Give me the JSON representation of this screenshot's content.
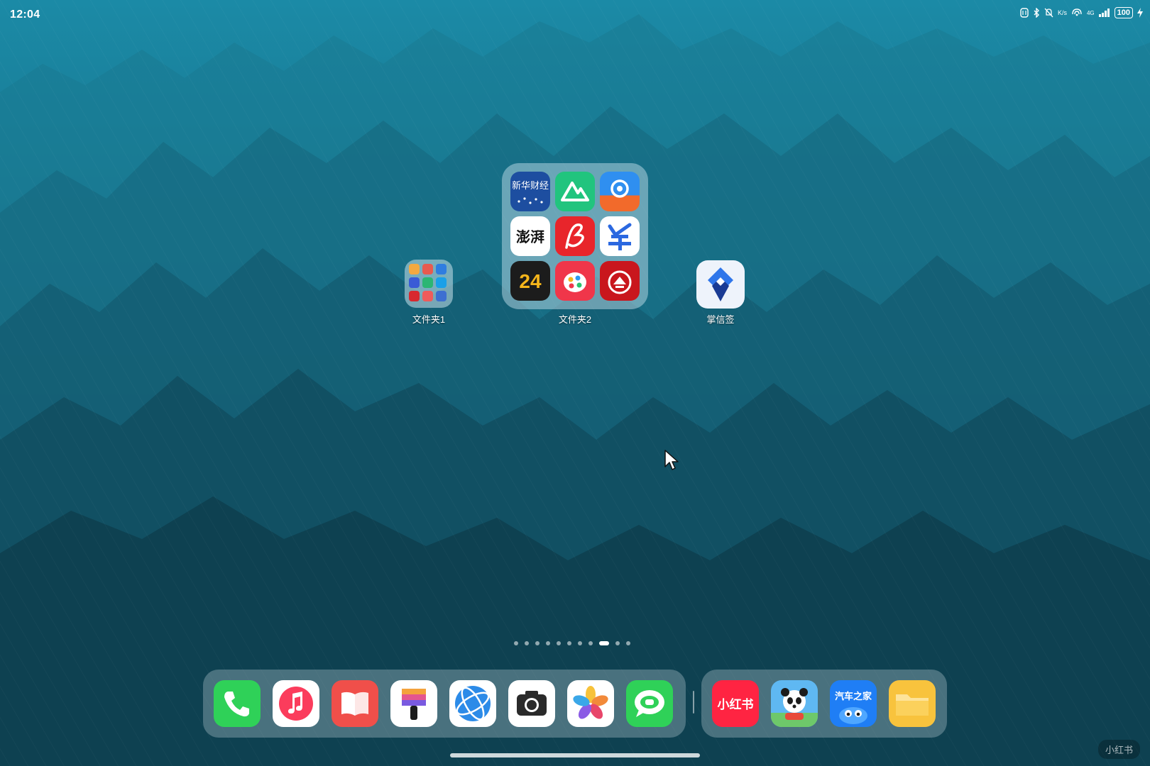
{
  "status_bar": {
    "time": "12:04",
    "net_speed": "K/s",
    "network_type": "4G",
    "battery_level": "100"
  },
  "home": {
    "folder1": {
      "label": "文件夹1",
      "mini_colors": [
        "#f4a940",
        "#e85a4f",
        "#2f7de0",
        "#3a5bd6",
        "#2bb673",
        "#1aa0e8",
        "#d8282f",
        "#ef5b5b",
        "#3d6fd1"
      ]
    },
    "folder2": {
      "label": "文件夹2",
      "apps": [
        {
          "icon": "xinhua-finance-icon",
          "text": "新华财经"
        },
        {
          "icon": "keep-mountain-icon",
          "text": ""
        },
        {
          "icon": "swirl-app-icon",
          "text": ""
        },
        {
          "icon": "thepaper-icon",
          "text": "澎湃"
        },
        {
          "icon": "red-signature-icon",
          "text": ""
        },
        {
          "icon": "blue-checkmark-app-icon",
          "text": ""
        },
        {
          "icon": "app-24-icon",
          "text": "24"
        },
        {
          "icon": "paint-palette-icon",
          "text": ""
        },
        {
          "icon": "red-emblem-icon",
          "text": ""
        }
      ]
    },
    "app_zhangxinqian": {
      "label": "掌信签",
      "icon": "zhangxinqian-icon"
    }
  },
  "pager": {
    "total": 11,
    "active_index": 8
  },
  "dock": {
    "main": [
      {
        "name": "phone-icon",
        "color": "#2fd158"
      },
      {
        "name": "music-icon",
        "color": "#fb3c5c"
      },
      {
        "name": "books-icon",
        "color": "#f04f4a"
      },
      {
        "name": "themes-icon",
        "color": "#ffffff"
      },
      {
        "name": "browser-icon",
        "color": "#2c8be8"
      },
      {
        "name": "camera-icon",
        "color": "#ffffff"
      },
      {
        "name": "photos-icon",
        "color": "#ffffff"
      },
      {
        "name": "messages-icon",
        "color": "#2fd158"
      }
    ],
    "recent": [
      {
        "name": "xiaohongshu-icon",
        "text": "小红书",
        "color": "#ff2442"
      },
      {
        "name": "baby-panda-icon",
        "color": "#5fb8f2"
      },
      {
        "name": "autohome-icon",
        "text": "汽车之家",
        "color": "#1f7ef5"
      },
      {
        "name": "files-icon",
        "color": "#f8c33d"
      }
    ]
  },
  "watermark": "小红书"
}
